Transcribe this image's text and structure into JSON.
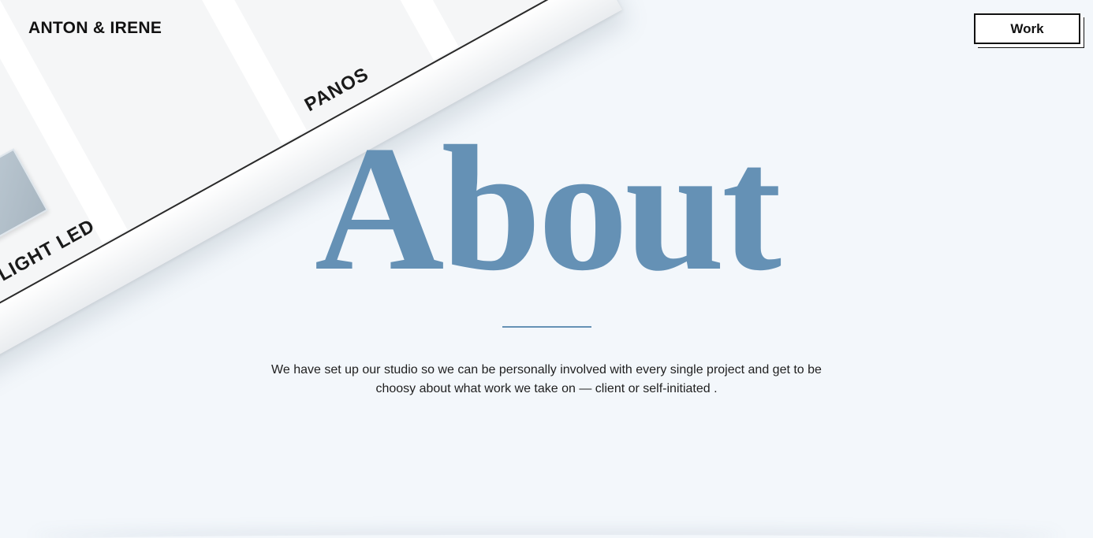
{
  "header": {
    "brand": "ANTON & IRENE",
    "nav_work_label": "Work"
  },
  "decor": {
    "product_labels": [
      "FLIGHT LED",
      "PANOS"
    ]
  },
  "hero": {
    "title": "About",
    "description": "We have set up our studio so we can be personally involved with every single project and get to be choosy about what work we take on — client or self-initiated ."
  },
  "colors": {
    "background": "#f3f7fb",
    "accent": "#6591b5",
    "text": "#1f1f1f"
  }
}
